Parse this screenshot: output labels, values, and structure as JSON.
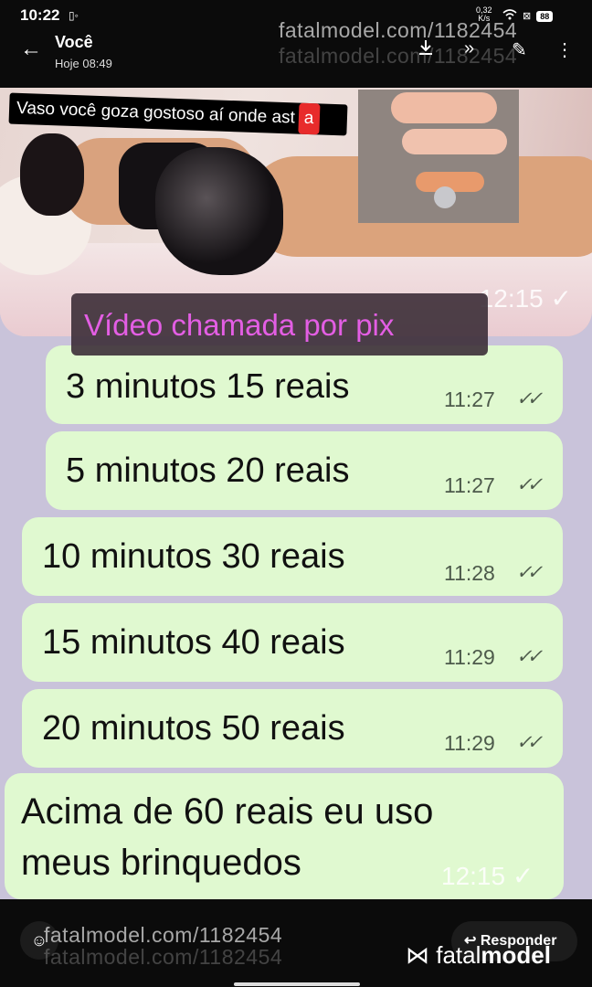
{
  "status": {
    "time": "10:22",
    "net_speed": "0,32",
    "net_unit": "K/s",
    "battery": "88"
  },
  "header": {
    "title": "Você",
    "subtitle": "Hoje 08:49"
  },
  "watermark": "fatalmodel.com/1182454",
  "photo": {
    "caption": "Vaso você goza gostoso aí onde ast",
    "caption_tail": "a",
    "time": "12:15"
  },
  "banner": "Vídeo chamada por pix",
  "messages": [
    {
      "text": "3 minutos 15 reais",
      "time": "11:27"
    },
    {
      "text": "5 minutos 20 reais",
      "time": "11:27"
    },
    {
      "text": "10 minutos 30 reais",
      "time": "11:28"
    },
    {
      "text": "15 minutos 40 reais",
      "time": "11:29"
    },
    {
      "text": "20 minutos 50 reais",
      "time": "11:29"
    }
  ],
  "last_message": {
    "line1": "Acima de 60 reais eu uso",
    "line2": "meus brinquedos",
    "time": "12:15"
  },
  "reply_label": "Responder",
  "logo": {
    "part1": "fatal",
    "part2": "model"
  },
  "colors": {
    "bubble": "#e0f9d0",
    "chat_bg": "#c9c3da",
    "banner_text": "#e35ee4"
  }
}
